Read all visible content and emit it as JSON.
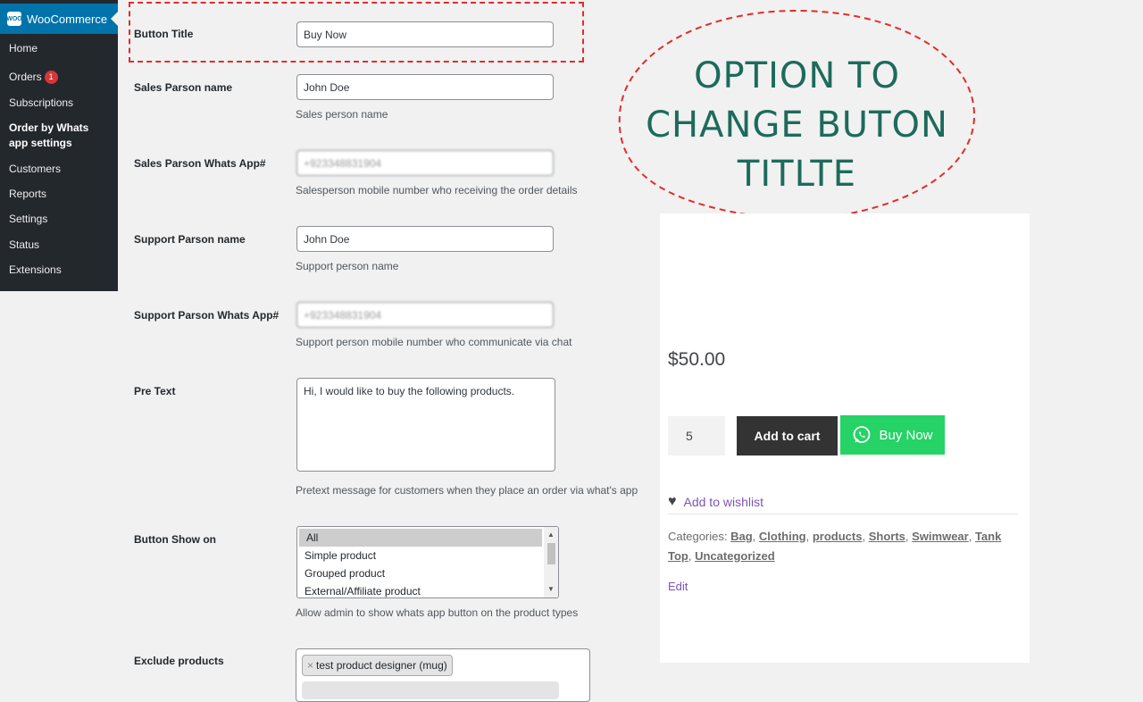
{
  "sidebar": {
    "brand": "WooCommerce",
    "logo_text": "WOO",
    "items": [
      {
        "label": "Home"
      },
      {
        "label": "Orders",
        "badge": "1"
      },
      {
        "label": "Subscriptions"
      },
      {
        "label": "Order by Whats app settings"
      },
      {
        "label": "Customers"
      },
      {
        "label": "Reports"
      },
      {
        "label": "Settings"
      },
      {
        "label": "Status"
      },
      {
        "label": "Extensions"
      }
    ]
  },
  "form": {
    "button_title": {
      "label": "Button Title",
      "value": "Buy Now"
    },
    "sales_name": {
      "label": "Sales Parson name",
      "value": "John Doe",
      "desc": "Sales person name"
    },
    "sales_whatsapp": {
      "label": "Sales Parson Whats App#",
      "value": "+923348831904",
      "desc": "Salesperson mobile number who receiving the order details"
    },
    "support_name": {
      "label": "Support Parson name",
      "value": "John Doe",
      "desc": "Support person name"
    },
    "support_whatsapp": {
      "label": "Support Parson Whats App#",
      "value": "+923348831904",
      "desc": "Support person mobile number who communicate via chat"
    },
    "pre_text": {
      "label": "Pre Text",
      "value": "Hi, I would like to buy the following products.",
      "desc": "Pretext message for customers when they place an order via what's app"
    },
    "button_show_on": {
      "label": "Button Show on",
      "options": [
        "All",
        "Simple product",
        "Grouped product",
        "External/Affiliate product"
      ],
      "selected": "All",
      "desc": "Allow admin to show whats app button on the product types"
    },
    "exclude_products": {
      "label": "Exclude products",
      "tags": [
        "test product designer (mug)"
      ]
    }
  },
  "callout": {
    "lines": [
      "OPTION TO",
      "CHANGE BUTON",
      "TITLTE"
    ],
    "color": "#1d6b5a",
    "border_color": "#e32b2b"
  },
  "product": {
    "price": "$50.00",
    "quantity": "5",
    "add_to_cart_label": "Add to cart",
    "buy_now_label": "Buy Now",
    "wishlist_label": "Add to wishlist",
    "categories_label": "Categories:",
    "categories": [
      "Bag",
      "Clothing",
      "products",
      "Shorts",
      "Swimwear",
      "Tank Top",
      "Uncategorized"
    ],
    "edit_label": "Edit"
  },
  "colors": {
    "sidebar_bg": "#23282d",
    "active_menu": "#0073aa",
    "whatsapp_green": "#25d366",
    "cart_button": "#333333",
    "accent_purple": "#7f54b3"
  }
}
